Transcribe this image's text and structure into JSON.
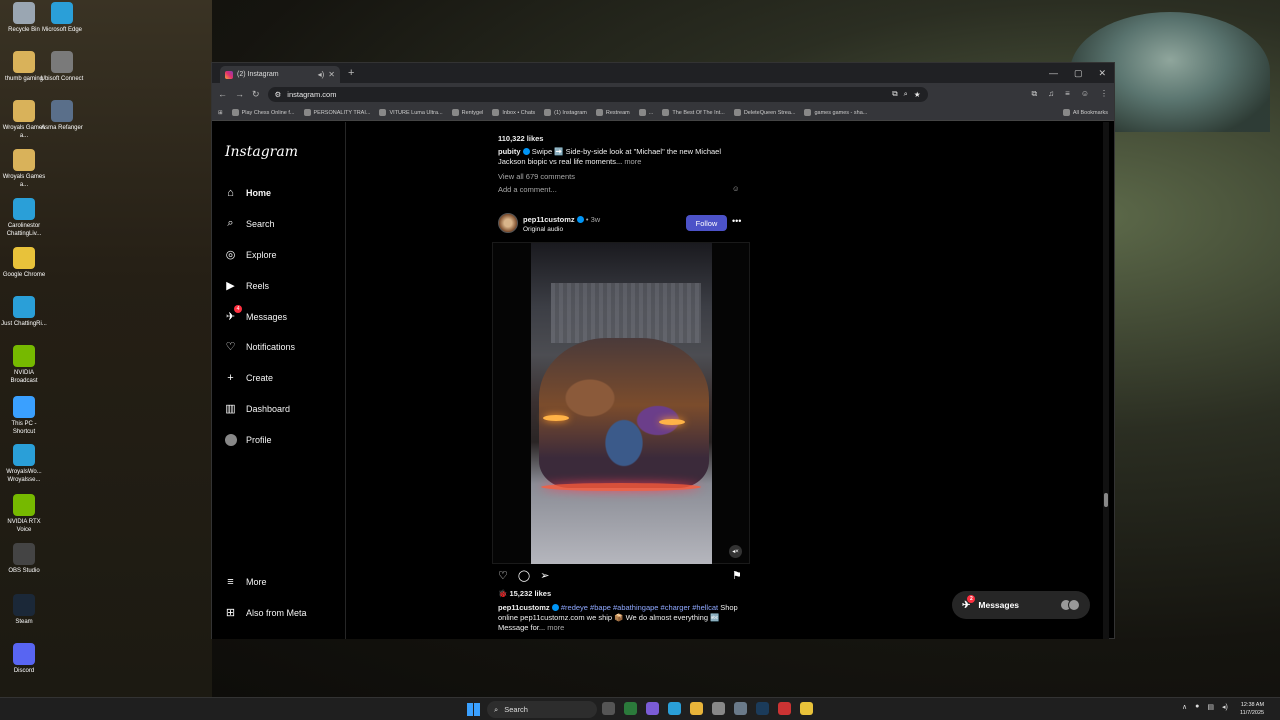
{
  "desktop": {
    "icons": [
      {
        "label": "Recycle Bin",
        "color": "#9aa6b2"
      },
      {
        "label": "Microsoft Edge",
        "color": "#2a9fd8"
      },
      {
        "label": "thumb gaming",
        "color": "#d9b25a"
      },
      {
        "label": "Ubisoft Connect",
        "color": "#7a7a7a"
      },
      {
        "label": "Wroyals Games a...",
        "color": "#d9b25a"
      },
      {
        "label": "Asma Refanger",
        "color": "#5a6f8a"
      },
      {
        "label": "Wroyals Games a...",
        "color": "#d9b25a"
      },
      {
        "label": "Carolinestor ChattingLiv...",
        "color": "#2a9fd8"
      },
      {
        "label": "Google Chrome",
        "color": "#e8c23a"
      },
      {
        "label": "Just ChattingRi...",
        "color": "#2a9fd8"
      },
      {
        "label": "NVIDIA Broadcast",
        "color": "#76b900"
      },
      {
        "label": "This PC - Shortcut",
        "color": "#3aa0ff"
      },
      {
        "label": "WroyalsWo... Wroyalsse...",
        "color": "#2a9fd8"
      },
      {
        "label": "NVIDIA RTX Voice",
        "color": "#76b900"
      },
      {
        "label": "OBS Studio",
        "color": "#444444"
      },
      {
        "label": "Steam",
        "color": "#1b2838"
      },
      {
        "label": "Discord",
        "color": "#5865f2"
      }
    ]
  },
  "browser": {
    "tab_title": "(2) Instagram",
    "url": "instagram.com",
    "bookmarks": [
      "Play Chess Online f...",
      "PERSONALITY TRAI...",
      "VITURE Luma Ultra...",
      "Rentygel",
      "Inbox • Chats",
      "(1) Instagram",
      "Restream",
      "...",
      "The Best Of The Int...",
      "DeleteQueen Strea...",
      "games games - sha...",
      "All Bookmarks"
    ]
  },
  "instagram": {
    "logo": "Instagram",
    "nav": {
      "home": "Home",
      "search": "Search",
      "explore": "Explore",
      "reels": "Reels",
      "messages": "Messages",
      "notifications": "Notifications",
      "create": "Create",
      "dashboard": "Dashboard",
      "profile": "Profile",
      "more": "More",
      "meta": "Also from Meta",
      "messages_badge": "4"
    },
    "prev_post": {
      "likes": "110,322 likes",
      "user": "pubity",
      "caption": "Swipe ➡️ Side-by-side look at \"Michael\" the new Michael Jackson biopic vs real life moments...",
      "more": "more",
      "comments": "View all 679 comments",
      "add_comment": "Add a comment..."
    },
    "post": {
      "user": "pep11customz",
      "age": "• 3w",
      "audio": "Original audio",
      "follow": "Follow",
      "likes": "15,232 likes",
      "caption_tags": "#redeye #bape #abathingape #charger #hellcat",
      "caption_text": "Shop online pep11customz.com we ship 📦 We do almost everything 🔤 Message for...",
      "more": "more"
    },
    "messages_pill": {
      "label": "Messages",
      "badge": "2"
    }
  },
  "taskbar": {
    "search": "Search",
    "time": "12:38 AM",
    "date": "11/7/2025"
  }
}
